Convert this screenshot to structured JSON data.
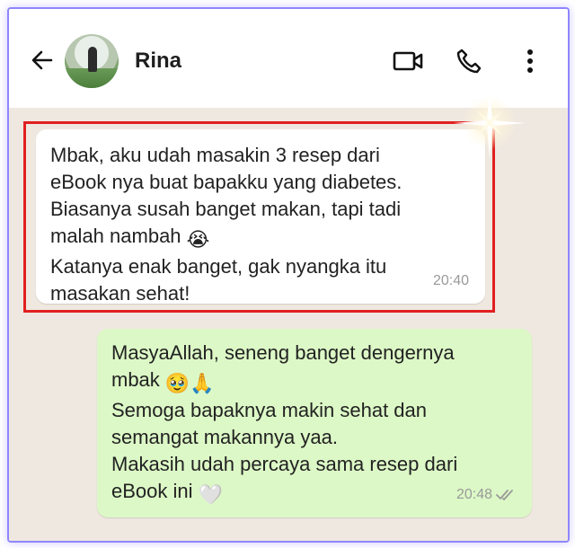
{
  "header": {
    "contact_name": "Rina",
    "back_icon": "arrow-left-icon",
    "video_icon": "video-camera-icon",
    "call_icon": "phone-icon",
    "menu_icon": "more-vertical-icon"
  },
  "messages": [
    {
      "direction": "incoming",
      "lines": [
        "Mbak, aku udah masakin 3 resep dari",
        "eBook nya buat bapakku yang diabetes.",
        "Biasanya susah banget makan, tapi tadi",
        "malah nambah",
        "Katanya enak banget, gak nyangka itu",
        "masakan sehat!"
      ],
      "emoji": "😭",
      "time": "20:40",
      "highlighted": true
    },
    {
      "direction": "outgoing",
      "lines": [
        "MasyaAllah, seneng banget dengernya",
        "mbak",
        "Semoga bapaknya makin sehat dan",
        "semangat makannya yaa.",
        "Makasih udah percaya sama resep dari",
        "eBook ini"
      ],
      "emoji_a": "🥹🙏",
      "emoji_b": "🤍",
      "time": "20:48",
      "status_icon": "double-check-icon"
    }
  ],
  "colors": {
    "incoming_bubble": "#ffffff",
    "outgoing_bubble": "#dcf8c6",
    "highlight_border": "#e02020",
    "frame_border": "#8f86ff",
    "chat_background": "#efe8e0"
  }
}
